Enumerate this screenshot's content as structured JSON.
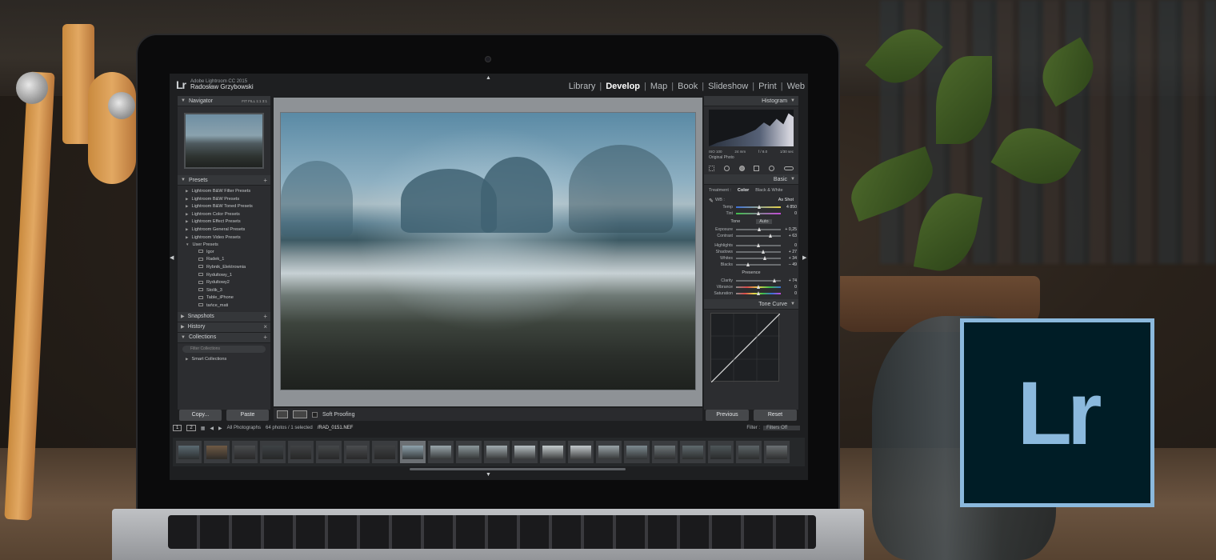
{
  "lightroom": {
    "logo": "Lr",
    "app_name": "Adobe Lightroom CC 2015",
    "user_name": "Radosław Grzybowski",
    "modules": [
      "Library",
      "Develop",
      "Map",
      "Book",
      "Slideshow",
      "Print",
      "Web"
    ],
    "active_module": "Develop",
    "left_panel": {
      "navigator_title": "Navigator",
      "navigator_options": "FIT  FILL  1:1  3:1",
      "presets_title": "Presets",
      "preset_folders": [
        "Lightroom B&W Filter Presets",
        "Lightroom B&W Presets",
        "Lightroom B&W Toned Presets",
        "Lightroom Color Presets",
        "Lightroom Effect Presets",
        "Lightroom General Presets",
        "Lightroom Video Presets",
        "User Presets"
      ],
      "user_presets": [
        "Igor",
        "Radek_1",
        "Rybnik_Elektrownia",
        "Rydultowy_1",
        "Rydultowy2",
        "Stolik_3",
        "Table_iPhone",
        "tańce_mati"
      ],
      "snapshots_title": "Snapshots",
      "history_title": "History",
      "collections_title": "Collections",
      "collections_search_placeholder": "Filter Collections",
      "collections_items": [
        "Smart Collections"
      ],
      "copy_button": "Copy...",
      "paste_button": "Paste"
    },
    "toolbar": {
      "soft_proofing_label": "Soft Proofing"
    },
    "right_panel": {
      "histogram_title": "Histogram",
      "iso": "ISO 100",
      "focal": "24 mm",
      "aperture": "f / 8.0",
      "shutter": "1/30 sec",
      "original_photo": "Original Photo",
      "basic_title": "Basic",
      "treatment_label": "Treatment :",
      "treatment_color": "Color",
      "treatment_bw": "Black & White",
      "wb_label": "WB :",
      "wb_value": "As Shot",
      "sliders_wb": [
        {
          "label": "Temp",
          "value": "4 850"
        },
        {
          "label": "Tint",
          "value": "0"
        }
      ],
      "tone_label": "Tone",
      "auto_label": "Auto",
      "sliders_tone_1": [
        {
          "label": "Exposure",
          "value": "+ 0,25"
        },
        {
          "label": "Contrast",
          "value": "+ 63"
        }
      ],
      "sliders_tone_2": [
        {
          "label": "Highlights",
          "value": "0"
        },
        {
          "label": "Shadows",
          "value": "+ 27"
        },
        {
          "label": "Whites",
          "value": "+ 34"
        },
        {
          "label": "Blacks",
          "value": "– 49"
        }
      ],
      "presence_label": "Presence",
      "sliders_presence": [
        {
          "label": "Clarity",
          "value": "+ 74"
        },
        {
          "label": "Vibrance",
          "value": "0"
        },
        {
          "label": "Saturation",
          "value": "0"
        }
      ],
      "tone_curve_title": "Tone Curve",
      "previous_button": "Previous",
      "reset_button": "Reset"
    },
    "filmstrip": {
      "page_1": "1",
      "page_2": "2",
      "source": "All Photographs",
      "count": "64 photos / 1 selected",
      "file": "/RAD_0151.NEF",
      "filter_label": "Filter :",
      "filter_value": "Filters Off"
    }
  },
  "badge": {
    "text": "Lr"
  },
  "colors": {
    "badge_bg": "#001d26",
    "badge_accent": "#8bb9dd",
    "panel": "#2c2d30"
  }
}
